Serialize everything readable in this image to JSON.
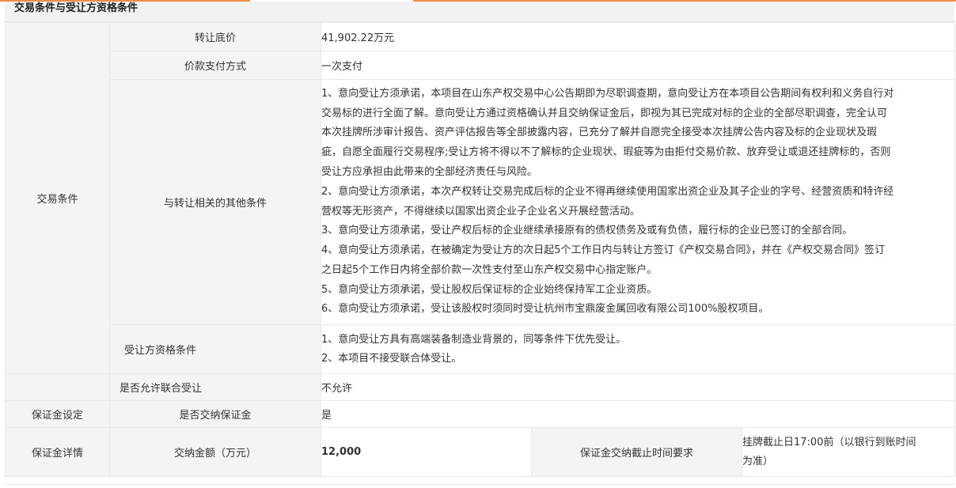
{
  "section_title": "交易条件与受让方资格条件",
  "rows": {
    "transfer_price": {
      "label": "转让底价",
      "value": "41,902.22万元"
    },
    "payment_method": {
      "label": "价款支付方式",
      "value": "一次支付"
    },
    "trade_conditions_group_label": "交易条件",
    "other_conditions": {
      "label": "与转让相关的其他条件",
      "lines": [
        "1、意向受让方须承诺，本项目在山东产权交易中心公告期即为尽职调查期，意向受让方在本项目公告期间有权利和义务自行对",
        "交易标的进行全面了解。意向受让方通过资格确认并且交纳保证金后，即视为其已完成对标的企业的全部尽职调查，完全认可",
        "本次挂牌所涉审计报告、资产评估报告等全部披露内容，已充分了解并自愿完全接受本次挂牌公告内容及标的企业现状及瑕",
        "疵，自愿全面履行交易程序;受让方将不得以不了解标的企业现状、瑕疵等为由拒付交易价款、放弃受让或退还挂牌标的，否则",
        "受让方应承担由此带来的全部经济责任与风险。",
        "2、意向受让方须承诺，本次产权转让交易完成后标的企业不得再继续使用国家出资企业及其子企业的字号、经营资质和特许经",
        "营权等无形资产，不得继续以国家出资企业子企业名义开展经营活动。",
        "3、意向受让方须承诺，受让产权后标的企业继续承接原有的债权债务及或有负债，履行标的企业已签订的全部合同。",
        "4、意向受让方须承诺，在被确定为受让方的次日起5个工作日内与转让方签订《产权交易合同》，并在《产权交易合同》签订",
        "之日起5个工作日内将全部价款一次性支付至山东产权交易中心指定账户。",
        "5、意向受让方须承诺，受让股权后保证标的企业始终保持军工企业资质。",
        "6、意向受让方须承诺，受让该股权时须同时受让杭州市宝鼎废金属回收有限公司100%股权项目。"
      ]
    },
    "qualification": {
      "label": "受让方资格条件",
      "lines": [
        "1、意向受让方具有高端装备制造业背景的，同等条件下优先受让。",
        "2、本项目不接受联合体受让。"
      ]
    },
    "joint_bid": {
      "label": "是否允许联合受让",
      "value": "不允许"
    },
    "deposit_setting": {
      "group_label": "保证金设定",
      "label": "是否交纳保证金",
      "value": "是"
    },
    "deposit_detail": {
      "group_label": "保证金详情",
      "amount_label": "交纳金额（万元）",
      "amount_value": "12,000",
      "deadline_label": "保证金交纳截止时间要求",
      "deadline_lines": [
        "挂牌截止日17:00前（以银行到账时间",
        "为准）"
      ]
    }
  }
}
